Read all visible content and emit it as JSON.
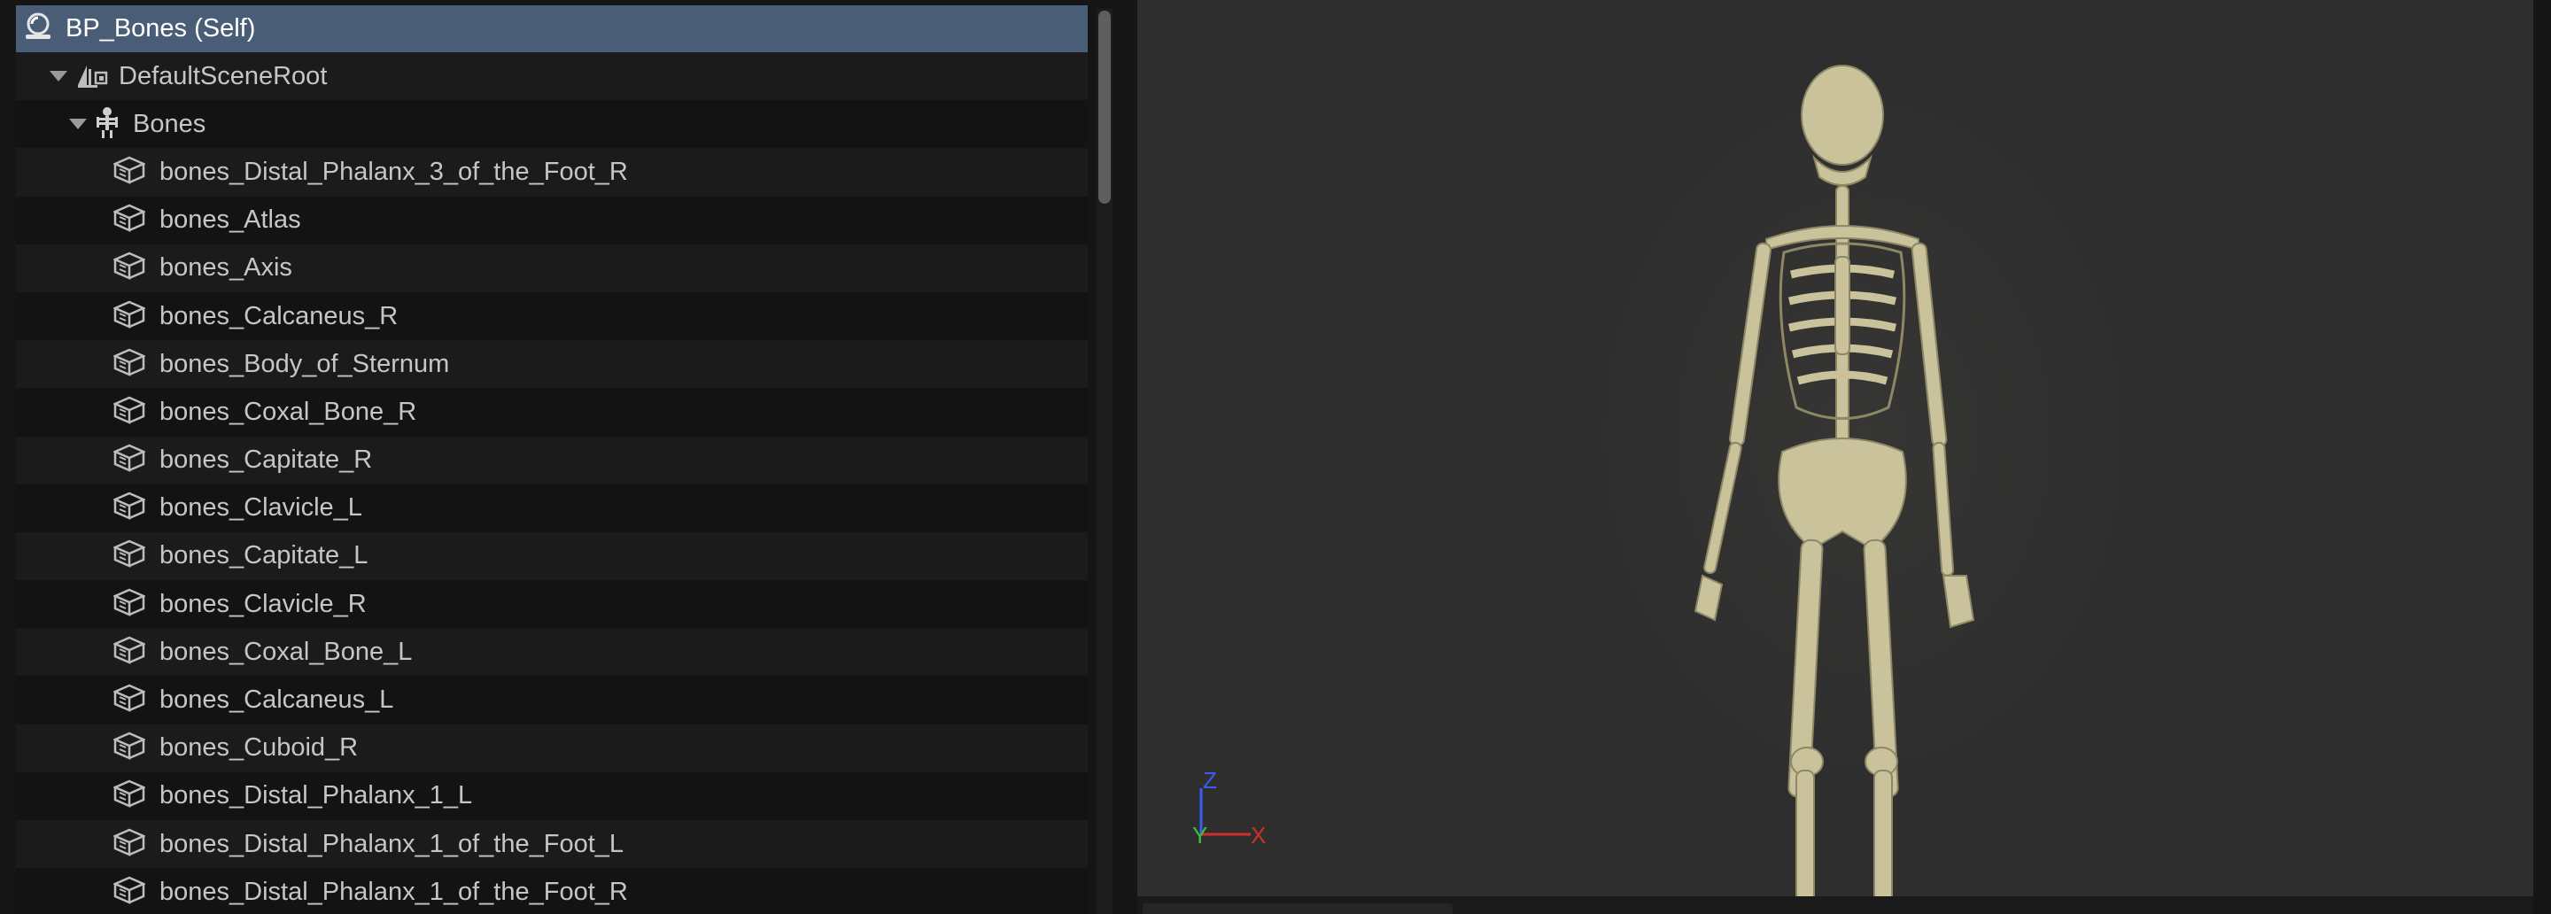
{
  "components": {
    "root": {
      "label": "BP_Bones (Self)",
      "icon": "blueprint-self-icon"
    },
    "scene_root": {
      "label": "DefaultSceneRoot",
      "icon": "scene-component-icon"
    },
    "bones_component": {
      "label": "Bones",
      "icon": "skeletal-mesh-icon"
    },
    "items": [
      {
        "label": "bones_Distal_Phalanx_3_of_the_Foot_R",
        "icon": "static-mesh-icon"
      },
      {
        "label": "bones_Atlas",
        "icon": "static-mesh-icon"
      },
      {
        "label": "bones_Axis",
        "icon": "static-mesh-icon"
      },
      {
        "label": "bones_Calcaneus_R",
        "icon": "static-mesh-icon"
      },
      {
        "label": "bones_Body_of_Sternum",
        "icon": "static-mesh-icon"
      },
      {
        "label": "bones_Coxal_Bone_R",
        "icon": "static-mesh-icon"
      },
      {
        "label": "bones_Capitate_R",
        "icon": "static-mesh-icon"
      },
      {
        "label": "bones_Clavicle_L",
        "icon": "static-mesh-icon"
      },
      {
        "label": "bones_Capitate_L",
        "icon": "static-mesh-icon"
      },
      {
        "label": "bones_Clavicle_R",
        "icon": "static-mesh-icon"
      },
      {
        "label": "bones_Coxal_Bone_L",
        "icon": "static-mesh-icon"
      },
      {
        "label": "bones_Calcaneus_L",
        "icon": "static-mesh-icon"
      },
      {
        "label": "bones_Cuboid_R",
        "icon": "static-mesh-icon"
      },
      {
        "label": "bones_Distal_Phalanx_1_L",
        "icon": "static-mesh-icon"
      },
      {
        "label": "bones_Distal_Phalanx_1_of_the_Foot_L",
        "icon": "static-mesh-icon"
      },
      {
        "label": "bones_Distal_Phalanx_1_of_the_Foot_R",
        "icon": "static-mesh-icon"
      }
    ]
  },
  "viewport": {
    "axis": {
      "z": "Z",
      "y": "Y",
      "x": "X"
    },
    "colors": {
      "x": "#d0302c",
      "y": "#3cc23c",
      "z": "#3a5cf0",
      "bone": "#c9c29a"
    }
  }
}
